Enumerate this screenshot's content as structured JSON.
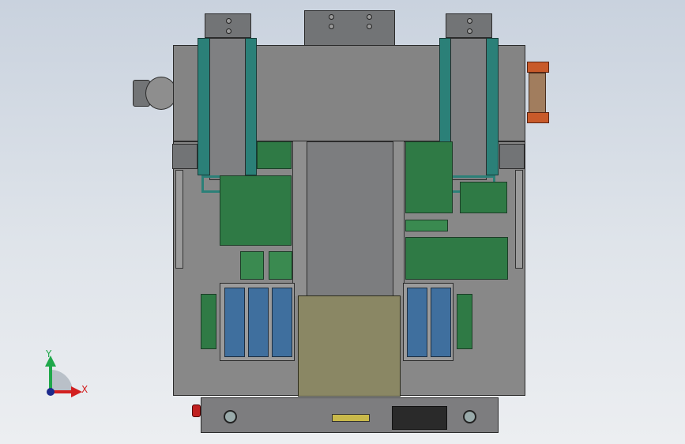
{
  "viewport": {
    "background_top": "#c9d2de",
    "background_bottom": "#eceef1"
  },
  "triad": {
    "y_label": "Y",
    "x_label": "X",
    "y_color": "#1fa84a",
    "x_color": "#d22020",
    "z_color": "#1c2a8c"
  },
  "colors": {
    "frame": "#8c8c8c",
    "pcb": "#2f7a45",
    "rail": "#2b8078",
    "slot": "#3f6f9e",
    "plate": "#8a8764",
    "display": "#c9b94a",
    "emergency": "#c02020",
    "handle": "#c85a2a"
  }
}
